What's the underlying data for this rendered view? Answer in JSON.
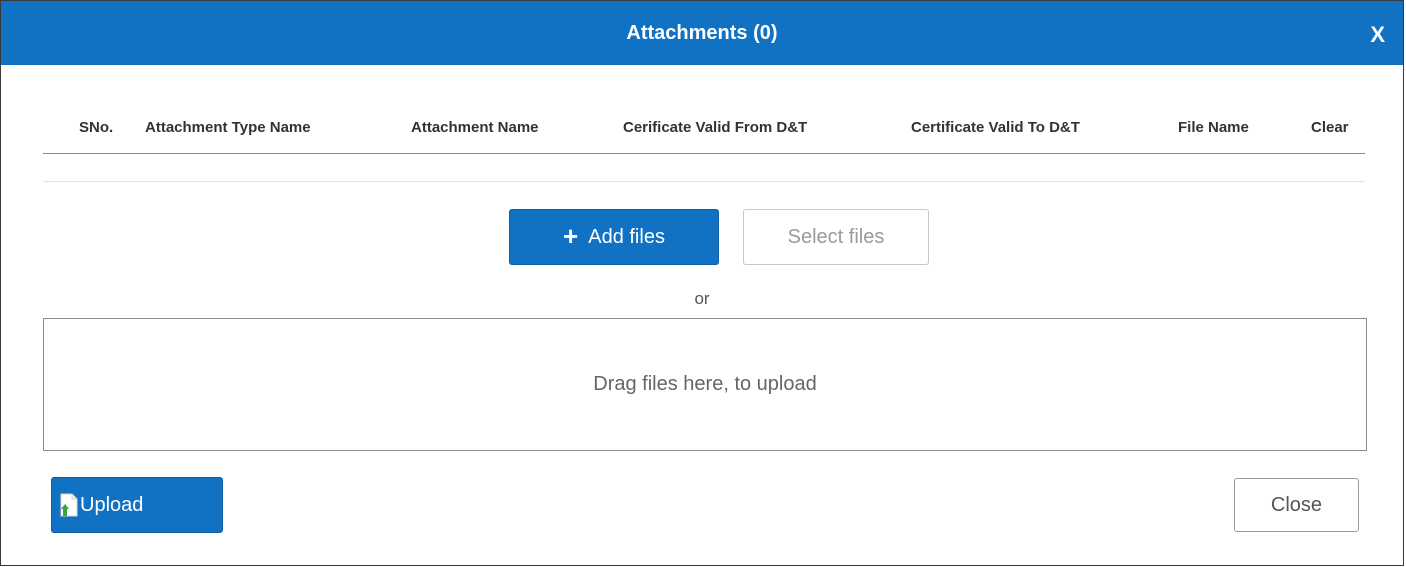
{
  "dialog": {
    "title": "Attachments (0)",
    "close_glyph": "X"
  },
  "table": {
    "columns": [
      "SNo.",
      "Attachment Type Name",
      "Attachment Name",
      "Cerificate Valid From D&T",
      "Certificate Valid To D&T",
      "File Name",
      "Clear"
    ],
    "rows": []
  },
  "actions": {
    "add_files_label": "Add files",
    "add_files_icon": "plus-icon",
    "select_files_label": "Select files",
    "or_text": "or",
    "dropzone_text": "Drag files here, to upload",
    "upload_label": "Upload",
    "upload_icon": "file-upload-icon",
    "close_label": "Close"
  },
  "colors": {
    "accent": "#1172c4",
    "upload_icon_arrow": "#3fa33a"
  }
}
